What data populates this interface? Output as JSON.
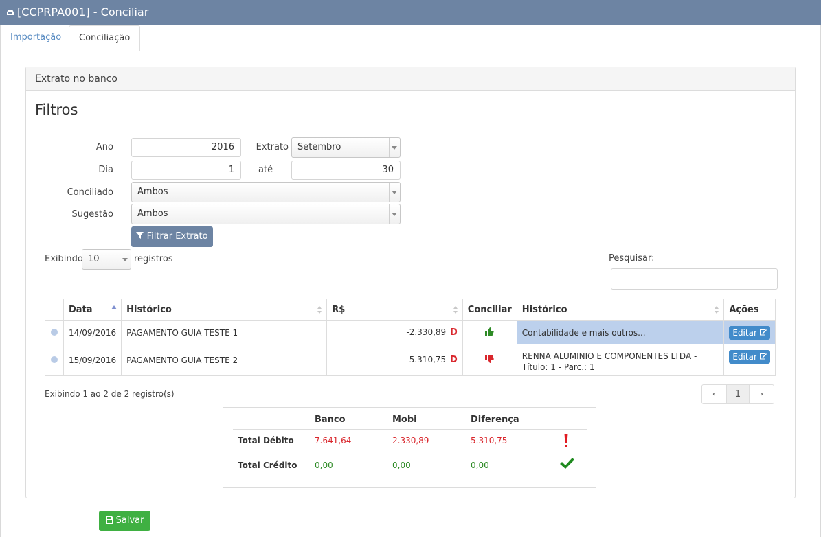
{
  "window": {
    "title": "[CCPRPA001] - Conciliar"
  },
  "tabs": [
    {
      "label": "Importação"
    },
    {
      "label": "Conciliação"
    }
  ],
  "panel": {
    "title": "Extrato no banco"
  },
  "filters": {
    "heading": "Filtros",
    "ano_label": "Ano",
    "ano_value": "2016",
    "extrato_label": "Extrato",
    "extrato_value": "Setembro",
    "dia_label": "Dia",
    "dia_value": "1",
    "ate_label": "até",
    "ate_value": "30",
    "conciliado_label": "Conciliado",
    "conciliado_value": "Ambos",
    "sugestao_label": "Sugestão",
    "sugestao_value": "Ambos",
    "filter_button": "Filtrar Extrato"
  },
  "list_controls": {
    "exibindo_label": "Exibindo",
    "page_size": "10",
    "registros_label": "registros",
    "search_label": "Pesquisar:",
    "search_value": ""
  },
  "table": {
    "headers": [
      "Data",
      "Histórico",
      "R$",
      "Conciliar",
      "Histórico",
      "Ações"
    ],
    "rows": [
      {
        "data": "14/09/2016",
        "historico": "PAGAMENTO GUIA TESTE 1",
        "valor": "-2.330,89",
        "flag": "D",
        "conciliar": "thumbs-up",
        "historico2": "Contabilidade e mais outros...",
        "acao": "Editar"
      },
      {
        "data": "15/09/2016",
        "historico": "PAGAMENTO GUIA TESTE 2",
        "valor": "-5.310,75",
        "flag": "D",
        "conciliar": "thumbs-down",
        "historico2": "RENNA ALUMINIO E COMPONENTES LTDA - Título: 1 - Parc.: 1",
        "acao": "Editar"
      }
    ]
  },
  "info": {
    "text": "Exibindo 1 ao 2 de 2 registro(s)"
  },
  "pagination": {
    "prev": "‹",
    "current": "1",
    "next": "›"
  },
  "totals": {
    "headers": [
      "Banco",
      "Mobi",
      "Diferença"
    ],
    "debito": {
      "label": "Total Débito",
      "banco": "7.641,64",
      "mobi": "2.330,89",
      "diferenca": "5.310,75",
      "status_icon": "exclamation-icon"
    },
    "credito": {
      "label": "Total Crédito",
      "banco": "0,00",
      "mobi": "0,00",
      "diferenca": "0,00",
      "status_icon": "check-icon"
    }
  },
  "save_button": "Salvar",
  "colors": {
    "header": "#6d84a3",
    "debit": "#d9262c",
    "credit": "#2e8b26",
    "save": "#3fb042",
    "edit": "#428bca",
    "highlight": "#bcd0ec"
  }
}
